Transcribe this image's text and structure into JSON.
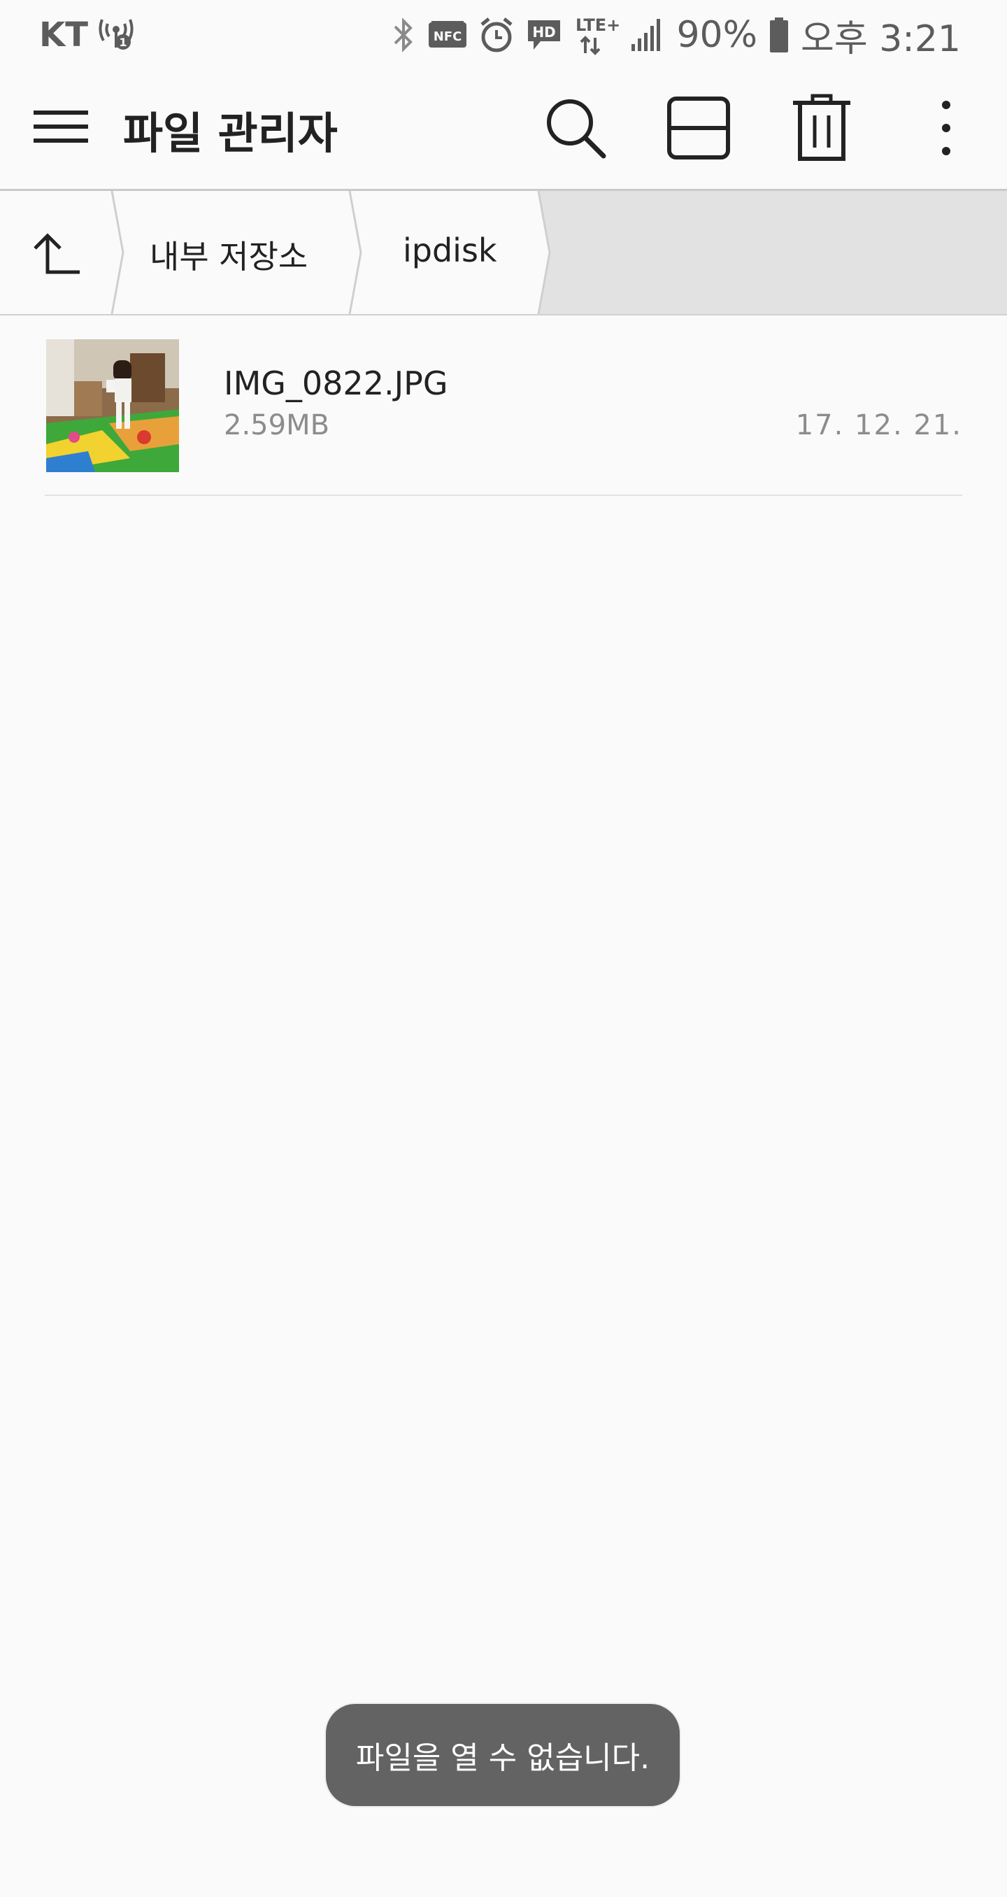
{
  "status_bar": {
    "carrier": "KT",
    "battery": "90%",
    "time": "오후 3:21",
    "icons": [
      "hotspot-icon",
      "bluetooth-icon",
      "nfc-icon",
      "alarm-icon",
      "hd-voice-icon",
      "lte-plus-icon",
      "signal-icon",
      "battery-icon"
    ],
    "nfc_label": "NFC",
    "hd_label": "HD",
    "lte_label": "LTE+"
  },
  "app_bar": {
    "title": "파일 관리자",
    "actions": [
      "search-icon",
      "view-mode-icon",
      "delete-icon",
      "more-options-icon"
    ]
  },
  "breadcrumb": {
    "items": [
      {
        "label": "내부 저장소"
      },
      {
        "label": "ipdisk"
      }
    ]
  },
  "files": [
    {
      "name": "IMG_0822.JPG",
      "size": "2.59MB",
      "date": "17. 12. 21."
    }
  ],
  "toast": {
    "message": "파일을 열 수 없습니다."
  },
  "colors": {
    "background": "#fafafa",
    "breadcrumb_bg": "#e2e2e2",
    "toast_bg": "#636363",
    "secondary_text": "#8c8c8c",
    "status_icons": "#5c5c5c"
  }
}
